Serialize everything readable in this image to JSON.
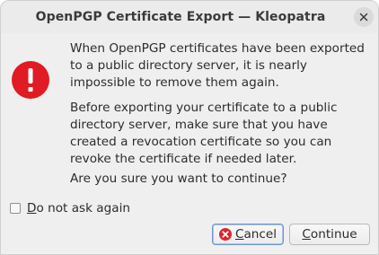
{
  "window": {
    "title": "OpenPGP Certificate Export — Kleopatra"
  },
  "message": {
    "paragraph1": "When OpenPGP certificates have been exported to a public directory server, it is nearly impossible to remove them again.",
    "paragraph2": "Before exporting your certificate to a public directory server, make sure that you have created a revocation certificate so you can revoke the certificate if needed later.",
    "question": "Are you sure you want to continue?"
  },
  "checkbox": {
    "label_mnemonic": "D",
    "label_rest": "o not ask again",
    "checked": false
  },
  "buttons": {
    "cancel_mnemonic": "C",
    "cancel_rest": "ancel",
    "continue_mnemonic": "C",
    "continue_rest": "ontinue"
  },
  "icons": {
    "warning": "warning-exclamation-icon",
    "close": "close-icon",
    "cancel": "cancel-icon"
  },
  "colors": {
    "warning_red": "#e01b24",
    "cancel_red": "#d9262f",
    "focus_border": "#6f96c8"
  }
}
